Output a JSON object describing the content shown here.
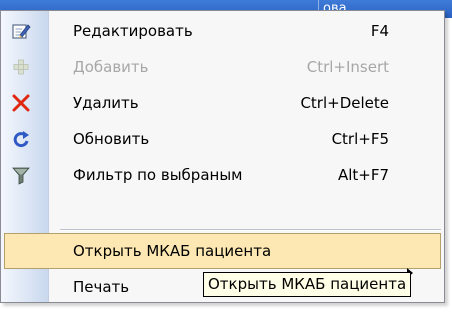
{
  "background": {
    "header_text": "ова",
    "header_color": "#2f6bd0"
  },
  "menu": {
    "items": [
      {
        "label": "Редактировать",
        "shortcut": "F4",
        "icon": "edit-icon",
        "enabled": true
      },
      {
        "label": "Добавить",
        "shortcut": "Ctrl+Insert",
        "icon": "add-plus-icon",
        "enabled": false
      },
      {
        "label": "Удалить",
        "shortcut": "Ctrl+Delete",
        "icon": "delete-x-icon",
        "enabled": true
      },
      {
        "label": "Обновить",
        "shortcut": "Ctrl+F5",
        "icon": "refresh-icon",
        "enabled": true
      },
      {
        "label": "Фильтр по выбраным",
        "shortcut": "Alt+F7",
        "icon": "filter-icon",
        "enabled": true
      },
      {
        "label": "Открыть МКАБ пациента",
        "shortcut": "",
        "icon": "",
        "enabled": true,
        "selected": true
      },
      {
        "label": "Печать",
        "shortcut": "",
        "icon": "",
        "enabled": true,
        "has_submenu": true
      }
    ],
    "selection_color": "#fde8b3",
    "gutter_color": "#d6e2f4"
  },
  "tooltip": {
    "text": "Открыть МКАБ пациента"
  }
}
